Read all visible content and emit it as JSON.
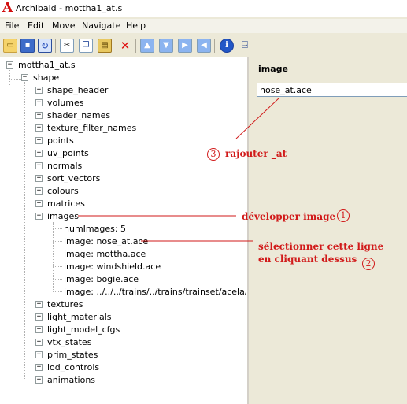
{
  "window": {
    "logo": "A",
    "title": "Archibald - mottha1_at.s"
  },
  "menu": [
    "File",
    "Edit",
    "Move",
    "Navigate",
    "Help"
  ],
  "toolbar": [
    "open-icon",
    "save-icon",
    "refresh-icon",
    "cut-icon",
    "copy-icon",
    "paste-icon",
    "delete-icon",
    "move-up-icon",
    "move-down-icon",
    "move-right-icon",
    "move-left-icon",
    "info-icon",
    "exit-icon"
  ],
  "tree": {
    "root": "mottha1_at.s",
    "shape": "shape",
    "children": [
      "shape_header",
      "volumes",
      "shader_names",
      "texture_filter_names",
      "points",
      "uv_points",
      "normals",
      "sort_vectors",
      "colours",
      "matrices"
    ],
    "images": "images",
    "image_children": [
      "numImages: 5",
      "image: nose_at.ace",
      "image: mottha.ace",
      "image: windshield.ace",
      "image: bogie.ace",
      "image: ../../../trains/../trains/trainset/acela/lock.a"
    ],
    "after": [
      "textures",
      "light_materials",
      "light_model_cfgs",
      "vtx_states",
      "prim_states",
      "lod_controls",
      "animations"
    ],
    "collapsed_symbol": "+",
    "expanded_symbol": "−"
  },
  "properties": {
    "label": "image",
    "value": "nose_at.ace"
  },
  "annotations": {
    "a1": {
      "text": "développer image",
      "num": "1"
    },
    "a2": {
      "line1": "sélectionner cette ligne",
      "line2": "en cliquant dessus",
      "num": "2"
    },
    "a3": {
      "text": "rajouter _at",
      "num": "3"
    }
  },
  "colors": {
    "annotation": "#d11a1a",
    "logo": "#d21010"
  }
}
